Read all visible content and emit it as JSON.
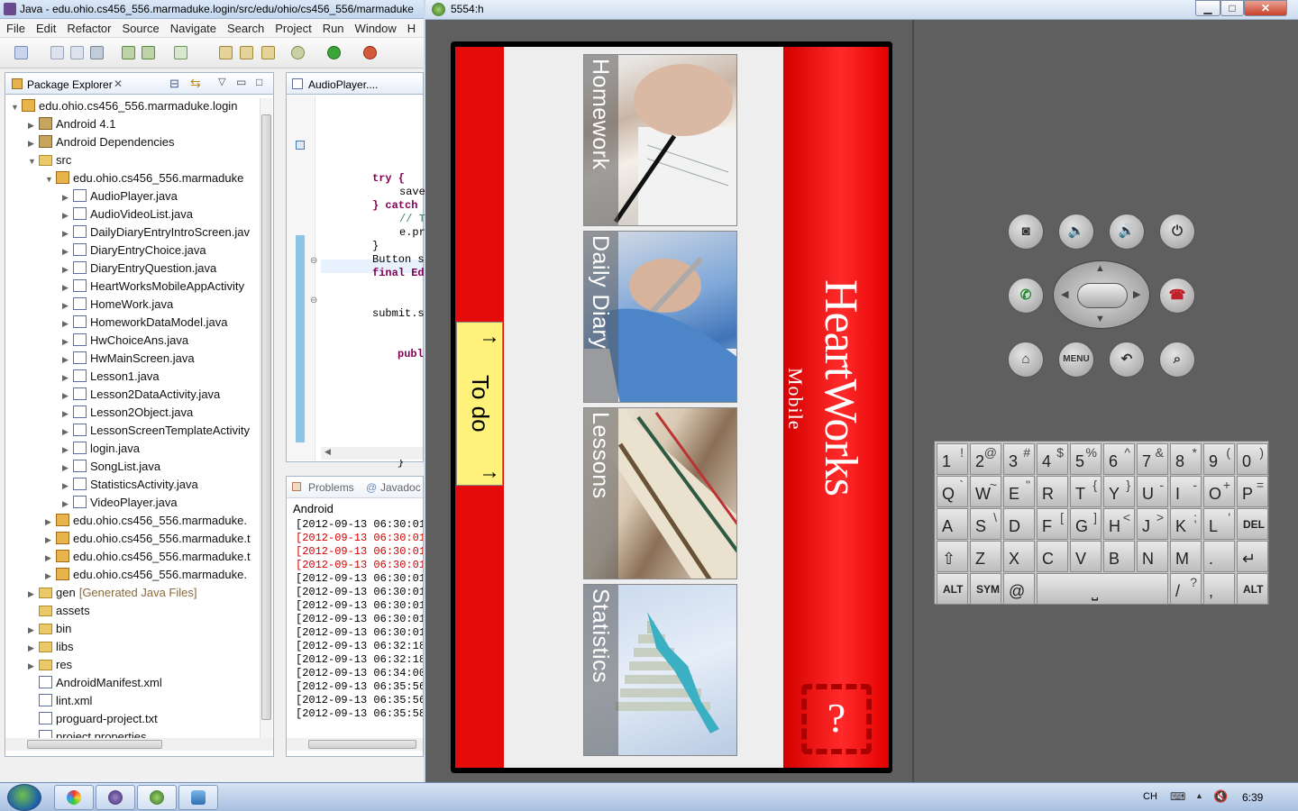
{
  "eclipse": {
    "title": "Java - edu.ohio.cs456_556.marmaduke.login/src/edu/ohio/cs456_556/marmaduke",
    "menu": [
      "File",
      "Edit",
      "Refactor",
      "Source",
      "Navigate",
      "Search",
      "Project",
      "Run",
      "Window",
      "H"
    ],
    "package_explorer": {
      "tab_label": "Package Explorer",
      "rows": [
        {
          "indent": 0,
          "arrow": "▼",
          "icon": "project",
          "label": "edu.ohio.cs456_556.marmaduke.login",
          "sub": ""
        },
        {
          "indent": 1,
          "arrow": "▶",
          "icon": "library",
          "label": "Android 4.1",
          "sub": ""
        },
        {
          "indent": 1,
          "arrow": "▶",
          "icon": "library",
          "label": "Android Dependencies",
          "sub": ""
        },
        {
          "indent": 1,
          "arrow": "▼",
          "icon": "folder",
          "label": "src",
          "sub": ""
        },
        {
          "indent": 2,
          "arrow": "▼",
          "icon": "package",
          "label": "edu.ohio.cs456_556.marmaduke",
          "sub": ""
        },
        {
          "indent": 3,
          "arrow": "▶",
          "icon": "java",
          "label": "AudioPlayer.java",
          "sub": ""
        },
        {
          "indent": 3,
          "arrow": "▶",
          "icon": "java",
          "label": "AudioVideoList.java",
          "sub": ""
        },
        {
          "indent": 3,
          "arrow": "▶",
          "icon": "java",
          "label": "DailyDiaryEntryIntroScreen.jav",
          "sub": ""
        },
        {
          "indent": 3,
          "arrow": "▶",
          "icon": "java",
          "label": "DiaryEntryChoice.java",
          "sub": ""
        },
        {
          "indent": 3,
          "arrow": "▶",
          "icon": "java",
          "label": "DiaryEntryQuestion.java",
          "sub": ""
        },
        {
          "indent": 3,
          "arrow": "▶",
          "icon": "java",
          "label": "HeartWorksMobileAppActivity",
          "sub": ""
        },
        {
          "indent": 3,
          "arrow": "▶",
          "icon": "java",
          "label": "HomeWork.java",
          "sub": ""
        },
        {
          "indent": 3,
          "arrow": "▶",
          "icon": "java",
          "label": "HomeworkDataModel.java",
          "sub": ""
        },
        {
          "indent": 3,
          "arrow": "▶",
          "icon": "java",
          "label": "HwChoiceAns.java",
          "sub": ""
        },
        {
          "indent": 3,
          "arrow": "▶",
          "icon": "java",
          "label": "HwMainScreen.java",
          "sub": ""
        },
        {
          "indent": 3,
          "arrow": "▶",
          "icon": "java",
          "label": "Lesson1.java",
          "sub": ""
        },
        {
          "indent": 3,
          "arrow": "▶",
          "icon": "java",
          "label": "Lesson2DataActivity.java",
          "sub": ""
        },
        {
          "indent": 3,
          "arrow": "▶",
          "icon": "java",
          "label": "Lesson2Object.java",
          "sub": ""
        },
        {
          "indent": 3,
          "arrow": "▶",
          "icon": "java",
          "label": "LessonScreenTemplateActivity",
          "sub": ""
        },
        {
          "indent": 3,
          "arrow": "▶",
          "icon": "java",
          "label": "login.java",
          "sub": ""
        },
        {
          "indent": 3,
          "arrow": "▶",
          "icon": "java",
          "label": "SongList.java",
          "sub": ""
        },
        {
          "indent": 3,
          "arrow": "▶",
          "icon": "java",
          "label": "StatisticsActivity.java",
          "sub": ""
        },
        {
          "indent": 3,
          "arrow": "▶",
          "icon": "java",
          "label": "VideoPlayer.java",
          "sub": ""
        },
        {
          "indent": 2,
          "arrow": "▶",
          "icon": "package",
          "label": "edu.ohio.cs456_556.marmaduke.",
          "sub": ""
        },
        {
          "indent": 2,
          "arrow": "▶",
          "icon": "package",
          "label": "edu.ohio.cs456_556.marmaduke.t",
          "sub": ""
        },
        {
          "indent": 2,
          "arrow": "▶",
          "icon": "package",
          "label": "edu.ohio.cs456_556.marmaduke.t",
          "sub": ""
        },
        {
          "indent": 2,
          "arrow": "▶",
          "icon": "package",
          "label": "edu.ohio.cs456_556.marmaduke.",
          "sub": ""
        },
        {
          "indent": 1,
          "arrow": "▶",
          "icon": "folder",
          "label": "gen",
          "sub": "[Generated Java Files]"
        },
        {
          "indent": 1,
          "arrow": "",
          "icon": "folder",
          "label": "assets",
          "sub": ""
        },
        {
          "indent": 1,
          "arrow": "▶",
          "icon": "folder",
          "label": "bin",
          "sub": ""
        },
        {
          "indent": 1,
          "arrow": "▶",
          "icon": "folder",
          "label": "libs",
          "sub": ""
        },
        {
          "indent": 1,
          "arrow": "▶",
          "icon": "folder",
          "label": "res",
          "sub": ""
        },
        {
          "indent": 1,
          "arrow": "",
          "icon": "xml",
          "label": "AndroidManifest.xml",
          "sub": ""
        },
        {
          "indent": 1,
          "arrow": "",
          "icon": "xml",
          "label": "lint.xml",
          "sub": ""
        },
        {
          "indent": 1,
          "arrow": "",
          "icon": "file",
          "label": "proguard-project.txt",
          "sub": ""
        },
        {
          "indent": 1,
          "arrow": "",
          "icon": "file",
          "label": "project.properties",
          "sub": ""
        }
      ]
    },
    "editor": {
      "tab_label": "AudioPlayer....",
      "lines": [
        {
          "text": "try {",
          "kw": true
        },
        {
          "text": "save",
          "kw": false
        },
        {
          "text": "} catch",
          "kw": true
        },
        {
          "text": "// T",
          "cm": true
        },
        {
          "text": "e.pr",
          "kw": false
        },
        {
          "text": "}",
          "kw": false
        },
        {
          "text": "Button s",
          "kw": false
        },
        {
          "text": "final Ed",
          "kw": true
        },
        {
          "text": "submit.s",
          "kw": false
        },
        {
          "text": "publ",
          "kw": true
        },
        {
          "text": "}",
          "kw": false
        },
        {
          "text": "});",
          "kw": false
        }
      ]
    },
    "console": {
      "tabs": [
        "Problems",
        "Javadoc"
      ],
      "header": "Android",
      "lines": [
        {
          "text": "[2012-09-13 06:30:01",
          "err": false
        },
        {
          "text": "[2012-09-13 06:30:01",
          "err": true
        },
        {
          "text": "[2012-09-13 06:30:01",
          "err": true
        },
        {
          "text": "[2012-09-13 06:30:01",
          "err": true
        },
        {
          "text": "[2012-09-13 06:30:01",
          "err": false
        },
        {
          "text": "[2012-09-13 06:30:01",
          "err": false
        },
        {
          "text": "[2012-09-13 06:30:01",
          "err": false
        },
        {
          "text": "[2012-09-13 06:30:01",
          "err": false
        },
        {
          "text": "[2012-09-13 06:30:01",
          "err": false
        },
        {
          "text": "[2012-09-13 06:32:18",
          "err": false
        },
        {
          "text": "[2012-09-13 06:32:18",
          "err": false
        },
        {
          "text": "[2012-09-13 06:34:00",
          "err": false
        },
        {
          "text": "[2012-09-13 06:35:56",
          "err": false
        },
        {
          "text": "[2012-09-13 06:35:56",
          "err": false
        },
        {
          "text": "[2012-09-13 06:35:58",
          "err": false
        }
      ]
    }
  },
  "emulator": {
    "title": "5554:h",
    "app": {
      "tiles": [
        "Homework",
        "Daily Diary",
        "Lessons",
        "Statistics"
      ],
      "todo_label": "To do",
      "brand": "HeartWorks",
      "brand_sub": "Mobile",
      "help_symbol": "?"
    },
    "controls": {
      "buttons": [
        "camera-icon",
        "volume-down-icon",
        "volume-up-icon",
        "power-icon",
        "call-icon",
        "end-call-icon",
        "home-icon",
        "menu",
        "back-icon",
        "search-icon"
      ],
      "menu_label": "MENU"
    },
    "keyboard": {
      "rows": [
        [
          [
            "1",
            "!"
          ],
          [
            "2",
            "@"
          ],
          [
            "3",
            "#"
          ],
          [
            "4",
            "$"
          ],
          [
            "5",
            "%"
          ],
          [
            "6",
            "^"
          ],
          [
            "7",
            "&"
          ],
          [
            "8",
            "*"
          ],
          [
            "9",
            "("
          ],
          [
            "0",
            ")"
          ]
        ],
        [
          [
            "Q",
            "`"
          ],
          [
            "W",
            "~"
          ],
          [
            "E",
            "\""
          ],
          [
            "R",
            ""
          ],
          [
            "T",
            "{"
          ],
          [
            "Y",
            "}"
          ],
          [
            "U",
            "-"
          ],
          [
            "I",
            "-"
          ],
          [
            "O",
            "+"
          ],
          [
            "P",
            "="
          ]
        ],
        [
          [
            "A",
            ""
          ],
          [
            "S",
            "\\"
          ],
          [
            "D",
            ""
          ],
          [
            "F",
            "["
          ],
          [
            "G",
            "]"
          ],
          [
            "H",
            "<"
          ],
          [
            "J",
            ">"
          ],
          [
            "K",
            ";"
          ],
          [
            "L",
            "'"
          ],
          [
            "DEL",
            ""
          ]
        ],
        [
          [
            "⇧",
            ""
          ],
          [
            "Z",
            ""
          ],
          [
            "X",
            ""
          ],
          [
            "C",
            ""
          ],
          [
            "V",
            ""
          ],
          [
            "B",
            ""
          ],
          [
            "N",
            ""
          ],
          [
            "M",
            ""
          ],
          [
            ".",
            ""
          ],
          [
            "↵",
            ""
          ]
        ],
        [
          [
            "ALT",
            ""
          ],
          [
            "SYM",
            ""
          ],
          [
            "@",
            ""
          ],
          [
            "space",
            ""
          ],
          [
            "/",
            "?"
          ],
          [
            ",",
            ""
          ],
          [
            "ALT",
            ""
          ]
        ]
      ]
    }
  },
  "taskbar": {
    "clock": "6:39",
    "tray_lang": "CH"
  }
}
